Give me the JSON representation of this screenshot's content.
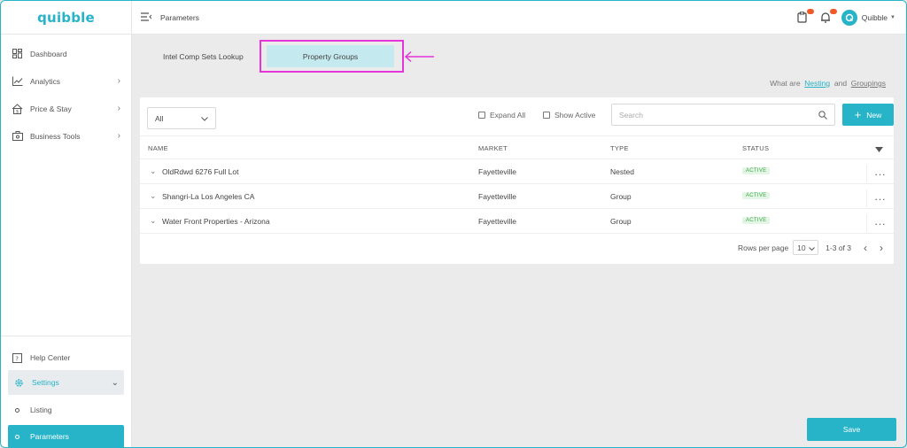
{
  "brand": {
    "logo_text": "quibble",
    "accent": "#27b3c8"
  },
  "sidebar": {
    "items": [
      {
        "label": "Dashboard",
        "icon": "dashboard-icon",
        "has_chevron": false
      },
      {
        "label": "Analytics",
        "icon": "analytics-icon",
        "has_chevron": true
      },
      {
        "label": "Price & Stay",
        "icon": "price-stay-icon",
        "has_chevron": true
      },
      {
        "label": "Business Tools",
        "icon": "business-tools-icon",
        "has_chevron": true
      }
    ],
    "bottom": {
      "help": "Help Center",
      "settings": "Settings",
      "sub_items": [
        {
          "label": "Listing",
          "active": false
        },
        {
          "label": "Parameters",
          "active": true
        }
      ]
    }
  },
  "topbar": {
    "title": "Parameters",
    "user_name": "Quibble"
  },
  "tabs": [
    {
      "label": "Intel Comp Sets Lookup",
      "active": false
    },
    {
      "label": "Property Groups",
      "active": true
    }
  ],
  "help_line": {
    "prefix": "What are",
    "link1": "Nesting",
    "and": "and",
    "link2": "Groupings"
  },
  "toolbar": {
    "filter_value": "All",
    "expand_all": "Expand All",
    "show_active": "Show Active",
    "search_placeholder": "Search",
    "new_label": "New"
  },
  "table": {
    "columns": [
      "NAME",
      "MARKET",
      "TYPE",
      "STATUS"
    ],
    "rows": [
      {
        "name": "OldRdwd 6276 Full Lot",
        "market": "Fayetteville",
        "type": "Nested",
        "status": "ACTIVE"
      },
      {
        "name": "Shangri-La Los Angeles CA",
        "market": "Fayetteville",
        "type": "Group",
        "status": "ACTIVE"
      },
      {
        "name": "Water Front Properties - Arizona",
        "market": "Fayetteville",
        "type": "Group",
        "status": "ACTIVE"
      }
    ]
  },
  "pagination": {
    "rows_per_page_label": "Rows per page",
    "rows_per_page": "10",
    "range": "1-3 of 3"
  },
  "save_label": "Save"
}
